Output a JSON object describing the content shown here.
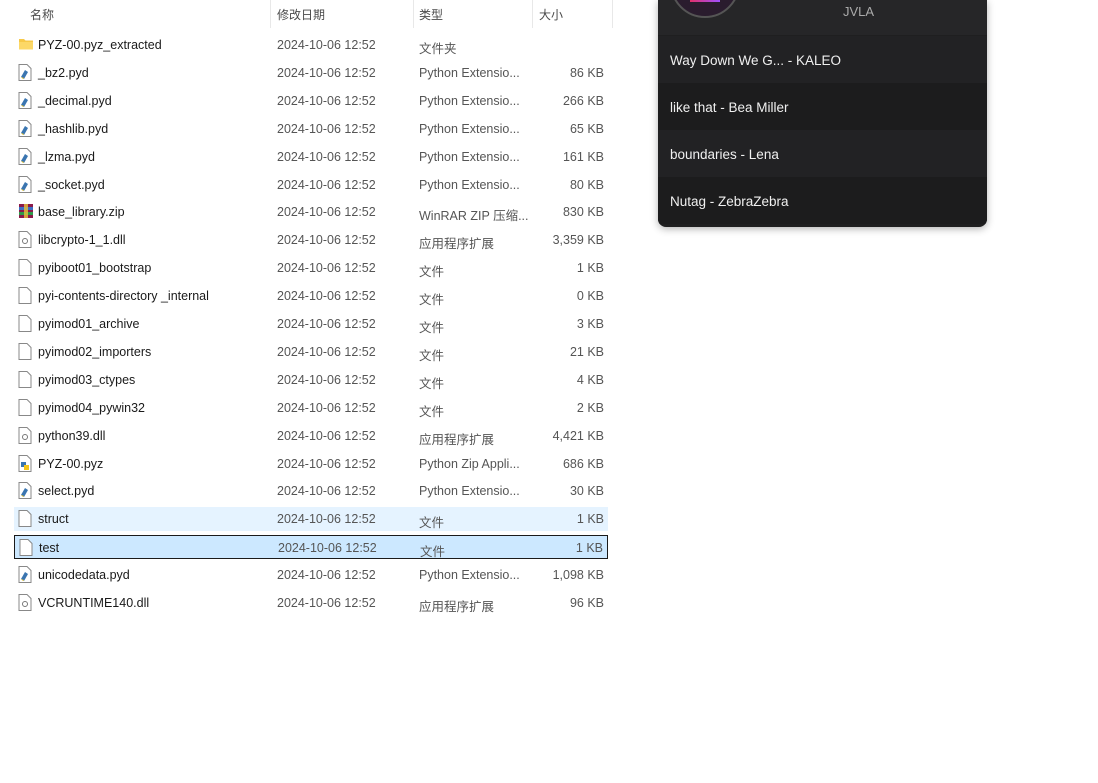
{
  "columns": {
    "name": "名称",
    "date": "修改日期",
    "type": "类型",
    "size": "大小"
  },
  "files": [
    {
      "name": "PYZ-00.pyz_extracted",
      "date": "2024-10-06 12:52",
      "type": "文件夹",
      "size": "",
      "icon": "folder"
    },
    {
      "name": "_bz2.pyd",
      "date": "2024-10-06 12:52",
      "type": "Python Extensio...",
      "size": "86 KB",
      "icon": "pyd"
    },
    {
      "name": "_decimal.pyd",
      "date": "2024-10-06 12:52",
      "type": "Python Extensio...",
      "size": "266 KB",
      "icon": "pyd"
    },
    {
      "name": "_hashlib.pyd",
      "date": "2024-10-06 12:52",
      "type": "Python Extensio...",
      "size": "65 KB",
      "icon": "pyd"
    },
    {
      "name": "_lzma.pyd",
      "date": "2024-10-06 12:52",
      "type": "Python Extensio...",
      "size": "161 KB",
      "icon": "pyd"
    },
    {
      "name": "_socket.pyd",
      "date": "2024-10-06 12:52",
      "type": "Python Extensio...",
      "size": "80 KB",
      "icon": "pyd"
    },
    {
      "name": "base_library.zip",
      "date": "2024-10-06 12:52",
      "type": "WinRAR ZIP 压缩...",
      "size": "830 KB",
      "icon": "zip"
    },
    {
      "name": "libcrypto-1_1.dll",
      "date": "2024-10-06 12:52",
      "type": "应用程序扩展",
      "size": "3,359 KB",
      "icon": "dll"
    },
    {
      "name": "pyiboot01_bootstrap",
      "date": "2024-10-06 12:52",
      "type": "文件",
      "size": "1 KB",
      "icon": "file"
    },
    {
      "name": "pyi-contents-directory _internal",
      "date": "2024-10-06 12:52",
      "type": "文件",
      "size": "0 KB",
      "icon": "file"
    },
    {
      "name": "pyimod01_archive",
      "date": "2024-10-06 12:52",
      "type": "文件",
      "size": "3 KB",
      "icon": "file"
    },
    {
      "name": "pyimod02_importers",
      "date": "2024-10-06 12:52",
      "type": "文件",
      "size": "21 KB",
      "icon": "file"
    },
    {
      "name": "pyimod03_ctypes",
      "date": "2024-10-06 12:52",
      "type": "文件",
      "size": "4 KB",
      "icon": "file"
    },
    {
      "name": "pyimod04_pywin32",
      "date": "2024-10-06 12:52",
      "type": "文件",
      "size": "2 KB",
      "icon": "file"
    },
    {
      "name": "python39.dll",
      "date": "2024-10-06 12:52",
      "type": "应用程序扩展",
      "size": "4,421 KB",
      "icon": "dll"
    },
    {
      "name": "PYZ-00.pyz",
      "date": "2024-10-06 12:52",
      "type": "Python Zip Appli...",
      "size": "686 KB",
      "icon": "pyz"
    },
    {
      "name": "select.pyd",
      "date": "2024-10-06 12:52",
      "type": "Python Extensio...",
      "size": "30 KB",
      "icon": "pyd"
    },
    {
      "name": "struct",
      "date": "2024-10-06 12:52",
      "type": "文件",
      "size": "1 KB",
      "icon": "file",
      "state": "hover"
    },
    {
      "name": "test",
      "date": "2024-10-06 12:52",
      "type": "文件",
      "size": "1 KB",
      "icon": "file",
      "state": "sel"
    },
    {
      "name": "unicodedata.pyd",
      "date": "2024-10-06 12:52",
      "type": "Python Extensio...",
      "size": "1,098 KB",
      "icon": "pyd"
    },
    {
      "name": "VCRUNTIME140.dll",
      "date": "2024-10-06 12:52",
      "type": "应用程序扩展",
      "size": "96 KB",
      "icon": "dll"
    }
  ],
  "player": {
    "artist": "JVLA",
    "queue": [
      "Way Down We G...  - KALEO",
      "like that - Bea Miller",
      "boundaries - Lena",
      "Nutag - ZebraZebra"
    ]
  }
}
